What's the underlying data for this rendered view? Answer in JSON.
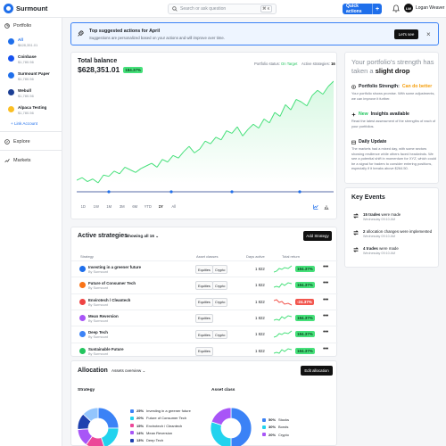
{
  "header": {
    "app_name": "Surmount",
    "search_placeholder": "Search or ask question",
    "shortcut": "⌘ K",
    "quick_actions": "Quick actions",
    "user_name": "Logan Weaver",
    "user_initials": "LW"
  },
  "sidebar": {
    "portfolio": "Portfolio",
    "accounts": [
      {
        "name": "All",
        "value": "$628,351.01",
        "color": "#1f6feb"
      },
      {
        "name": "Coinbase",
        "value": "$1,780.56",
        "color": "#1652f0"
      },
      {
        "name": "Surmount Paper",
        "value": "$1,780.56",
        "color": "#1f6feb"
      },
      {
        "name": "Webull",
        "value": "$1,780.56",
        "color": "#1c3f94"
      },
      {
        "name": "Alpaca Testing",
        "value": "$1,780.56",
        "color": "#fbbf24"
      }
    ],
    "link_account": "+ Link Account",
    "explore": "Explore",
    "markets": "Markets"
  },
  "banner": {
    "title": "Top suggested actions for April",
    "subtitle": "Suggestions are personalized based on your actions and will improve over time.",
    "button": "Let's see"
  },
  "balance": {
    "label": "Total balance",
    "value": "$628,351.01",
    "change": "184.37%",
    "status_label": "Portfolio status:",
    "status_value": "On Target",
    "active_label": "Active strategies:",
    "active_value": "16",
    "timeframes": [
      "1D",
      "1W",
      "1M",
      "3M",
      "6M",
      "YTD",
      "1Y",
      "All"
    ],
    "selected_tf": "1Y"
  },
  "chart_data": {
    "type": "line",
    "title": "Total balance",
    "values": [
      14,
      16,
      13,
      15,
      12,
      18,
      17,
      21,
      19,
      24,
      22,
      20,
      23,
      25,
      27,
      24,
      30,
      28,
      33,
      31,
      36,
      40,
      35,
      38,
      44,
      42,
      47,
      45,
      52,
      50,
      55,
      48,
      53,
      57,
      54,
      61,
      58,
      66,
      63,
      72,
      68,
      76,
      74,
      71,
      79,
      83,
      80,
      86,
      90
    ]
  },
  "panel": {
    "title_1": "Your portfolio's strength has taken a",
    "title_2": "slight drop",
    "s1_title": "Portfolio Strength:",
    "s1_value": "Can do better",
    "s1_body": "Your portfolio shows promise. With some adjustments, we can improve it further.",
    "s2_prefix": "New",
    "s2_title": "Insights available",
    "s2_body": "Read the latest assessment of the strengths of each of your portfolios.",
    "s3_title": "Daily Update",
    "s3_body": "The markets had a mixed day, with some sectors showing resilience while others faced headwinds. We see a potential shift in momentum for XYZ, which could be a signal for traders to consider entering positions, especially if it breaks above $264.50."
  },
  "events": {
    "title": "Key Events",
    "items": [
      {
        "bold": "15 trades",
        "rest": "were made",
        "date": "Wednesday 09:10 AM"
      },
      {
        "bold": "2",
        "rest": "allocation changes were implemented",
        "date": "Wednesday 09:10 AM"
      },
      {
        "bold": "4 trades",
        "rest": "were made",
        "date": "Wednesday 09:10 AM"
      }
    ]
  },
  "strategies": {
    "title": "Active strategies",
    "filter": "Showing all 16",
    "add": "Add Strategy",
    "headers": [
      "Strategy",
      "Asset classes",
      "Days active",
      "Total return"
    ],
    "rows": [
      {
        "name": "Investing in a greener future",
        "by": "By Surmount",
        "chips": [
          "Equities",
          "Crypto"
        ],
        "days": "1 822",
        "ret": "184.37%",
        "neg": false,
        "color": "#1f6feb"
      },
      {
        "name": "Future of Consumer Tech",
        "by": "By Surmount",
        "chips": [
          "Equities",
          "Crypto"
        ],
        "days": "1 822",
        "ret": "184.37%",
        "neg": false,
        "color": "#f97316"
      },
      {
        "name": "Envirotech / Cleantech",
        "by": "By Surmount",
        "chips": [
          "Equities",
          "Crypto"
        ],
        "days": "1 822",
        "ret": "-24.37%",
        "neg": true,
        "color": "#ef4444"
      },
      {
        "name": "Mean Reversion",
        "by": "By Surmount",
        "chips": [
          "Equities"
        ],
        "days": "1 822",
        "ret": "184.37%",
        "neg": false,
        "color": "#a855f7"
      },
      {
        "name": "Deep Tech",
        "by": "By Surmount",
        "chips": [
          "Equities",
          "Crypto"
        ],
        "days": "1 822",
        "ret": "184.37%",
        "neg": false,
        "color": "#3b82f6"
      },
      {
        "name": "Sustainable Future",
        "by": "By Surmount",
        "chips": [
          "Equities"
        ],
        "days": "1 822",
        "ret": "184.37%",
        "neg": false,
        "color": "#22c55e"
      }
    ]
  },
  "allocation": {
    "title": "Allocation",
    "dropdown": "Assets overview",
    "edit": "Edit allocation",
    "strategy_title": "Strategy",
    "asset_title": "Asset class",
    "strategy_legend": [
      {
        "pct": "25%",
        "name": "Investing in a greener future",
        "color": "#3b82f6"
      },
      {
        "pct": "20%",
        "name": "Future of Consumer Tech",
        "color": "#22d3ee"
      },
      {
        "pct": "15%",
        "name": "Envirotech / Cleantech",
        "color": "#ec4899"
      },
      {
        "pct": "14%",
        "name": "Mean Reversion",
        "color": "#a855f7"
      },
      {
        "pct": "13%",
        "name": "Deep Tech",
        "color": "#1e40af"
      },
      {
        "pct": "13%",
        "name": "Sustainable Future",
        "color": "#93c5fd"
      }
    ],
    "asset_legend": [
      {
        "pct": "50%",
        "name": "Stocks",
        "color": "#3b82f6"
      },
      {
        "pct": "30%",
        "name": "Bonds",
        "color": "#22d3ee"
      },
      {
        "pct": "20%",
        "name": "Crypto",
        "color": "#a855f7"
      }
    ]
  }
}
